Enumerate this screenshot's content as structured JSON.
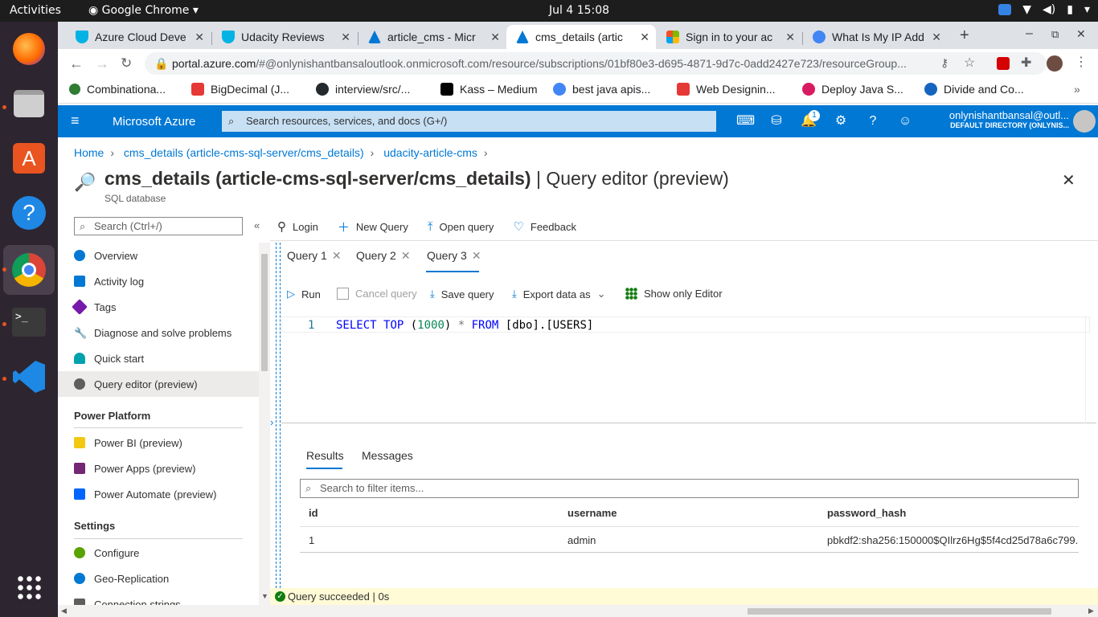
{
  "system": {
    "activities": "Activities",
    "app_name": "Google Chrome",
    "clock": "Jul 4  15:08"
  },
  "tabs": [
    {
      "title": "Azure Cloud Deve",
      "icon": "udacity-icon",
      "color": "#02b3e4"
    },
    {
      "title": "Udacity Reviews",
      "icon": "udacity-icon",
      "color": "#02b3e4"
    },
    {
      "title": "article_cms - Micr",
      "icon": "azure-icon",
      "color": "#0078d4"
    },
    {
      "title": "cms_details (artic",
      "icon": "azure-icon",
      "color": "#0078d4",
      "active": true
    },
    {
      "title": "Sign in to your ac",
      "icon": "microsoft-icon",
      "color": "#f25022"
    },
    {
      "title": "What Is My IP Add",
      "icon": "globe-icon",
      "color": "#4285f4"
    }
  ],
  "address": {
    "domain": "portal.azure.com",
    "path": "/#@onlynishantbansaloutlook.onmicrosoft.com/resource/subscriptions/01bf80e3-d695-4871-9d7c-0add2427e723/resourceGroup..."
  },
  "bookmarks": [
    {
      "label": "Combinationa...",
      "color": "#2e7d32"
    },
    {
      "label": "BigDecimal (J...",
      "color": "#e53935"
    },
    {
      "label": "interview/src/...",
      "color": "#24292e"
    },
    {
      "label": "Kass – Medium",
      "color": "#000000"
    },
    {
      "label": "best java apis...",
      "color": "#4285f4"
    },
    {
      "label": "Web Designin...",
      "color": "#e53935"
    },
    {
      "label": "Deploy Java S...",
      "color": "#d81b60"
    },
    {
      "label": "Divide and Co...",
      "color": "#1565c0"
    }
  ],
  "azure": {
    "brand": "Microsoft Azure",
    "search_placeholder": "Search resources, services, and docs (G+/)",
    "notification_count": "1",
    "user_email": "onlynishantbansal@outl...",
    "directory": "DEFAULT DIRECTORY (ONLYNIS..."
  },
  "breadcrumb": [
    "Home",
    "cms_details (article-cms-sql-server/cms_details)",
    "udacity-article-cms"
  ],
  "page": {
    "title_main": "cms_details (article-cms-sql-server/cms_details)",
    "title_suffix": " | Query editor (preview)",
    "subtitle": "SQL database"
  },
  "nav": {
    "search_placeholder": "Search (Ctrl+/)",
    "items": [
      {
        "label": "Overview",
        "color": "#0078d4"
      },
      {
        "label": "Activity log",
        "color": "#0078d4"
      },
      {
        "label": "Tags",
        "color": "#7719aa"
      },
      {
        "label": "Diagnose and solve problems",
        "color": "#605e5c"
      },
      {
        "label": "Quick start",
        "color": "#00a2ad"
      },
      {
        "label": "Query editor (preview)",
        "color": "#605e5c"
      }
    ],
    "sections": [
      {
        "heading": "Power Platform",
        "items": [
          "Power BI (preview)",
          "Power Apps (preview)",
          "Power Automate (preview)"
        ]
      },
      {
        "heading": "Settings",
        "items": [
          "Configure",
          "Geo-Replication",
          "Connection strings"
        ]
      }
    ]
  },
  "commands": [
    "Login",
    "New Query",
    "Open query",
    "Feedback"
  ],
  "query_tabs": [
    "Query 1",
    "Query 2",
    "Query 3"
  ],
  "query_toolbar": [
    "Run",
    "Cancel query",
    "Save query",
    "Export data as",
    "Show only Editor"
  ],
  "editor": {
    "line_number": "1",
    "tokens": [
      "SELECT",
      " ",
      "TOP",
      " (",
      "1000",
      ") ",
      "*",
      " ",
      "FROM",
      " [dbo].[USERS]"
    ]
  },
  "results": {
    "tabs": [
      "Results",
      "Messages"
    ],
    "filter_placeholder": "Search to filter items...",
    "columns": [
      "id",
      "username",
      "password_hash"
    ],
    "rows": [
      [
        "1",
        "admin",
        "pbkdf2:sha256:150000$QIlrz6Hg$5f4cd25d78a6c799..."
      ]
    ]
  },
  "status": "Query succeeded | 0s"
}
